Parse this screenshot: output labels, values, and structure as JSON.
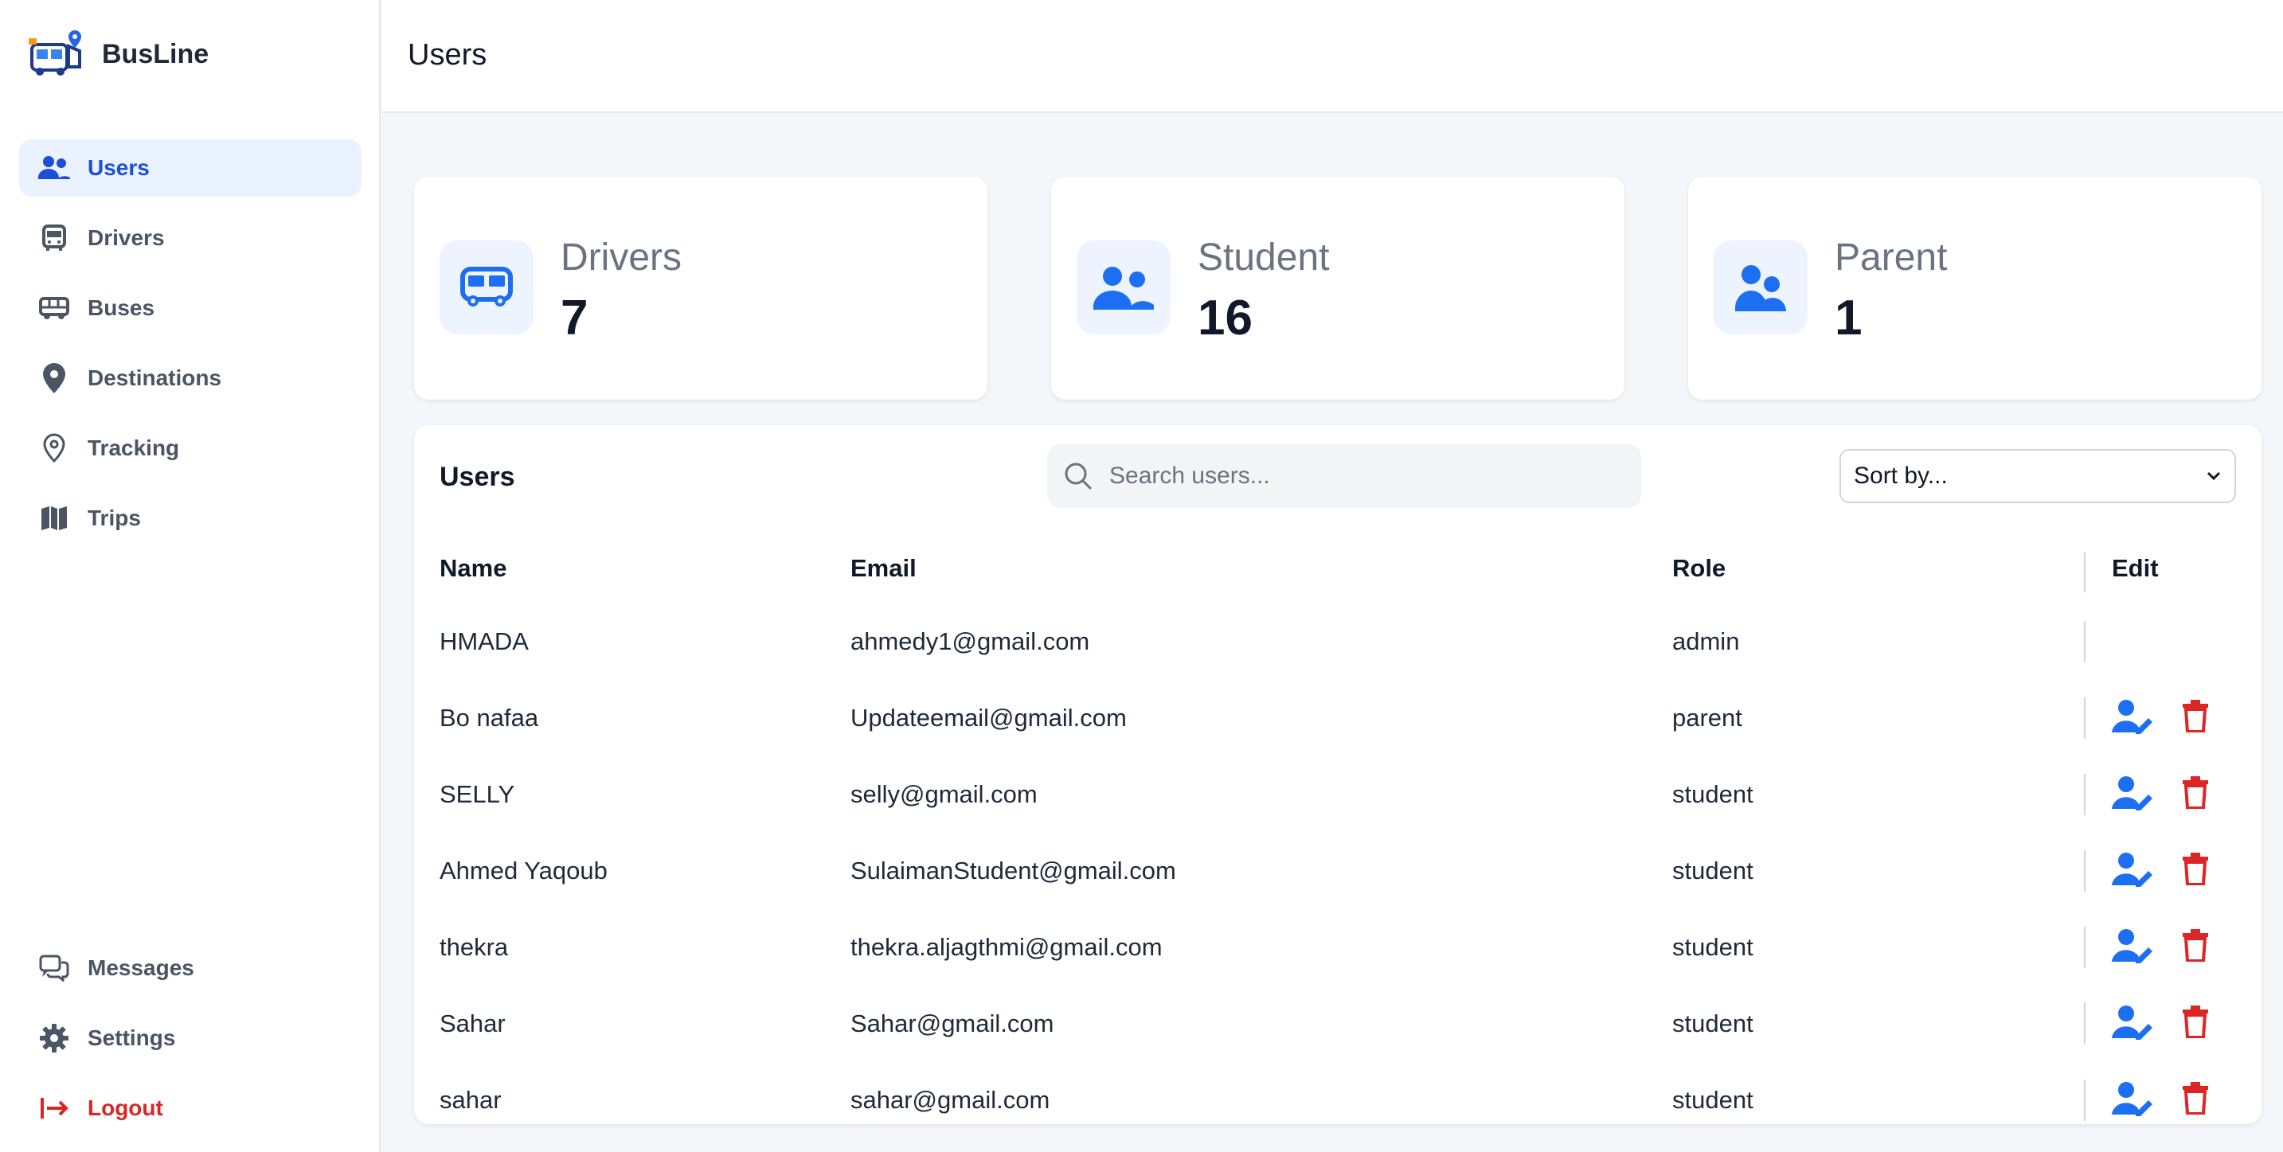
{
  "app": {
    "name": "BusLine"
  },
  "sidebar": {
    "items": [
      {
        "label": "Users",
        "icon": "users-icon",
        "active": true
      },
      {
        "label": "Drivers",
        "icon": "bus-front-icon"
      },
      {
        "label": "Buses",
        "icon": "bus-side-icon"
      },
      {
        "label": "Destinations",
        "icon": "map-pin-icon"
      },
      {
        "label": "Tracking",
        "icon": "location-outline-icon"
      },
      {
        "label": "Trips",
        "icon": "map-icon"
      }
    ],
    "bottom": [
      {
        "label": "Messages",
        "icon": "chat-icon"
      },
      {
        "label": "Settings",
        "icon": "gear-icon"
      },
      {
        "label": "Logout",
        "icon": "logout-icon"
      }
    ]
  },
  "header": {
    "title": "Users"
  },
  "stats": [
    {
      "label": "Drivers",
      "value": "7",
      "icon": "bus-icon"
    },
    {
      "label": "Student",
      "value": "16",
      "icon": "users-icon"
    },
    {
      "label": "Parent",
      "value": "1",
      "icon": "user-pair-icon"
    }
  ],
  "users_panel": {
    "title": "Users",
    "search_placeholder": "Search users...",
    "sort_label": "Sort by...",
    "columns": {
      "name": "Name",
      "email": "Email",
      "role": "Role",
      "edit": "Edit"
    },
    "rows": [
      {
        "name": "HMADA",
        "email": "ahmedy1@gmail.com",
        "role": "admin",
        "editable": false
      },
      {
        "name": "Bo nafaa",
        "email": "Updateemail@gmail.com",
        "role": "parent",
        "editable": true
      },
      {
        "name": "SELLY",
        "email": "selly@gmail.com",
        "role": "student",
        "editable": true
      },
      {
        "name": "Ahmed Yaqoub",
        "email": "SulaimanStudent@gmail.com",
        "role": "student",
        "editable": true
      },
      {
        "name": "thekra",
        "email": "thekra.aljagthmi@gmail.com",
        "role": "student",
        "editable": true
      },
      {
        "name": "Sahar",
        "email": "Sahar@gmail.com",
        "role": "student",
        "editable": true
      },
      {
        "name": "sahar",
        "email": "sahar@gmail.com",
        "role": "student",
        "editable": true
      }
    ]
  },
  "colors": {
    "accent": "#1d6ff2",
    "danger": "#dc2626",
    "active_bg": "#eaf2ff"
  }
}
